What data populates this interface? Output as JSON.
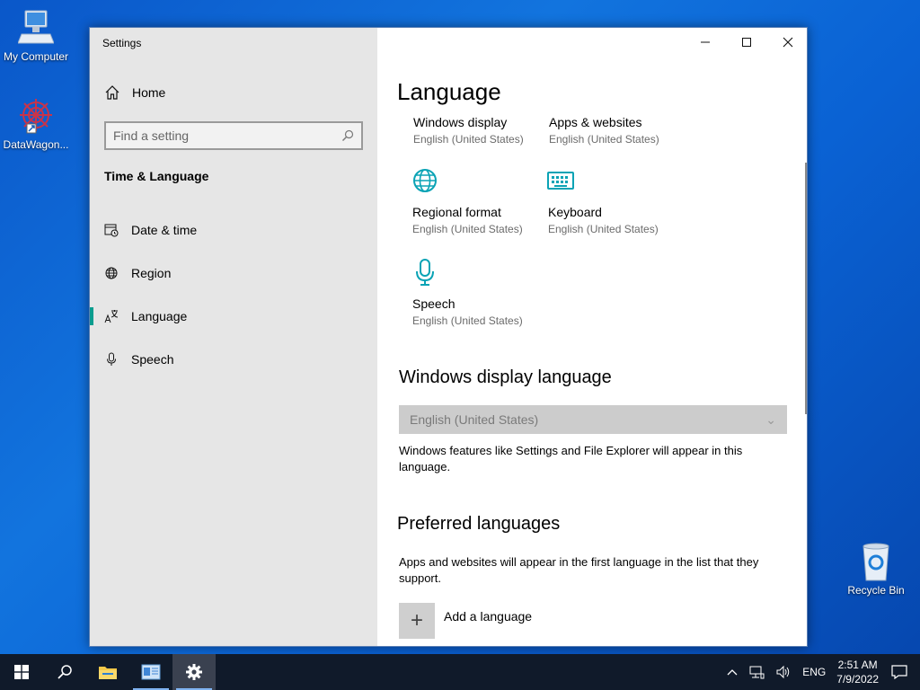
{
  "desktop": {
    "icons": [
      {
        "label": "My Computer"
      },
      {
        "label": "DataWagon..."
      },
      {
        "label": "Recycle Bin"
      }
    ]
  },
  "window": {
    "title": "Settings",
    "sidebar": {
      "home": "Home",
      "search_placeholder": "Find a setting",
      "section": "Time & Language",
      "items": [
        {
          "label": "Date & time",
          "icon": "calendar-clock-icon"
        },
        {
          "label": "Region",
          "icon": "globe-icon"
        },
        {
          "label": "Language",
          "icon": "language-icon",
          "active": true
        },
        {
          "label": "Speech",
          "icon": "microphone-icon"
        }
      ]
    },
    "content": {
      "title": "Language",
      "tiles": [
        {
          "title": "Windows display",
          "subtitle": "English (United States)"
        },
        {
          "title": "Apps & websites",
          "subtitle": "English (United States)"
        },
        {
          "title": "Regional format",
          "subtitle": "English (United States)",
          "icon": "globe-icon"
        },
        {
          "title": "Keyboard",
          "subtitle": "English (United States)",
          "icon": "keyboard-icon"
        },
        {
          "title": "Speech",
          "subtitle": "English (United States)",
          "icon": "microphone-icon"
        }
      ],
      "display_language": {
        "heading": "Windows display language",
        "selected": "English (United States)",
        "description": "Windows features like Settings and File Explorer will appear in this language."
      },
      "preferred": {
        "heading": "Preferred languages",
        "description": "Apps and websites will appear in the first language in the list that they support.",
        "add_label": "Add a language"
      }
    }
  },
  "taskbar": {
    "language": "ENG",
    "time": "2:51 AM",
    "date": "7/9/2022"
  },
  "colors": {
    "accent": "#0a9d8f",
    "icon_teal": "#0aa3b5",
    "taskbar": "#101a2a"
  }
}
